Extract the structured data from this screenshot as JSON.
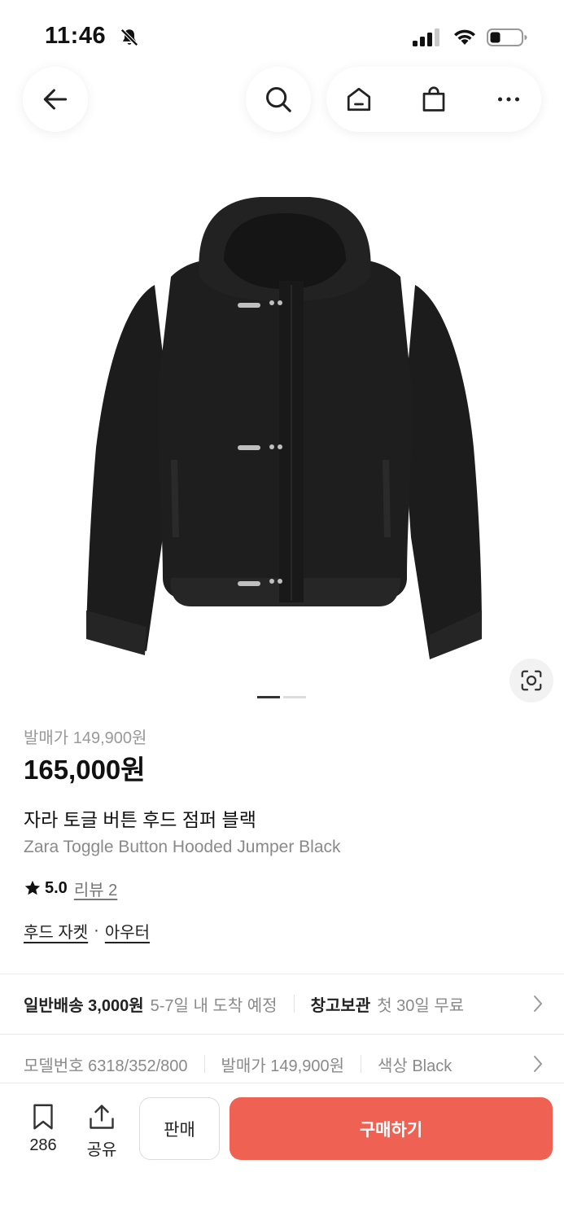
{
  "status_bar": {
    "time": "11:46",
    "icons": [
      "bell-slash-icon",
      "signal-icon",
      "wifi-icon",
      "battery-icon"
    ]
  },
  "nav": {
    "icons": [
      "arrow-left-icon",
      "search-icon",
      "home-icon",
      "shopping-bag-icon",
      "more-icon"
    ]
  },
  "gallery": {
    "image_subject": "black hooded jacket with toggle buttons",
    "active_index": 1,
    "total": 2
  },
  "product": {
    "release_price": "발매가 149,900원",
    "price": "165,000원",
    "name_ko": "자라 토글 버튼 후드 점퍼 블랙",
    "name_en": "Zara Toggle Button Hooded Jumper Black",
    "rating": "5.0",
    "reviews": "리뷰 2",
    "category_1": "후드 자켓",
    "category_sep": "·",
    "category_2": "아우터"
  },
  "shipping": {
    "label": "일반배송 3,000원",
    "eta": "5-7일 내 도착 예정",
    "storage_label": "창고보관",
    "storage_info": "첫 30일 무료"
  },
  "details": {
    "model": "모델번호 6318/352/800",
    "release": "발매가 149,900원",
    "color": "색상 Black"
  },
  "bottom_bar": {
    "bookmark_count": "286",
    "share_label": "공유",
    "sell_label": "판매",
    "buy_label": "구매하기"
  },
  "colors": {
    "accent": "#ef6253",
    "text": "#222222",
    "muted": "#8a8a8a"
  }
}
